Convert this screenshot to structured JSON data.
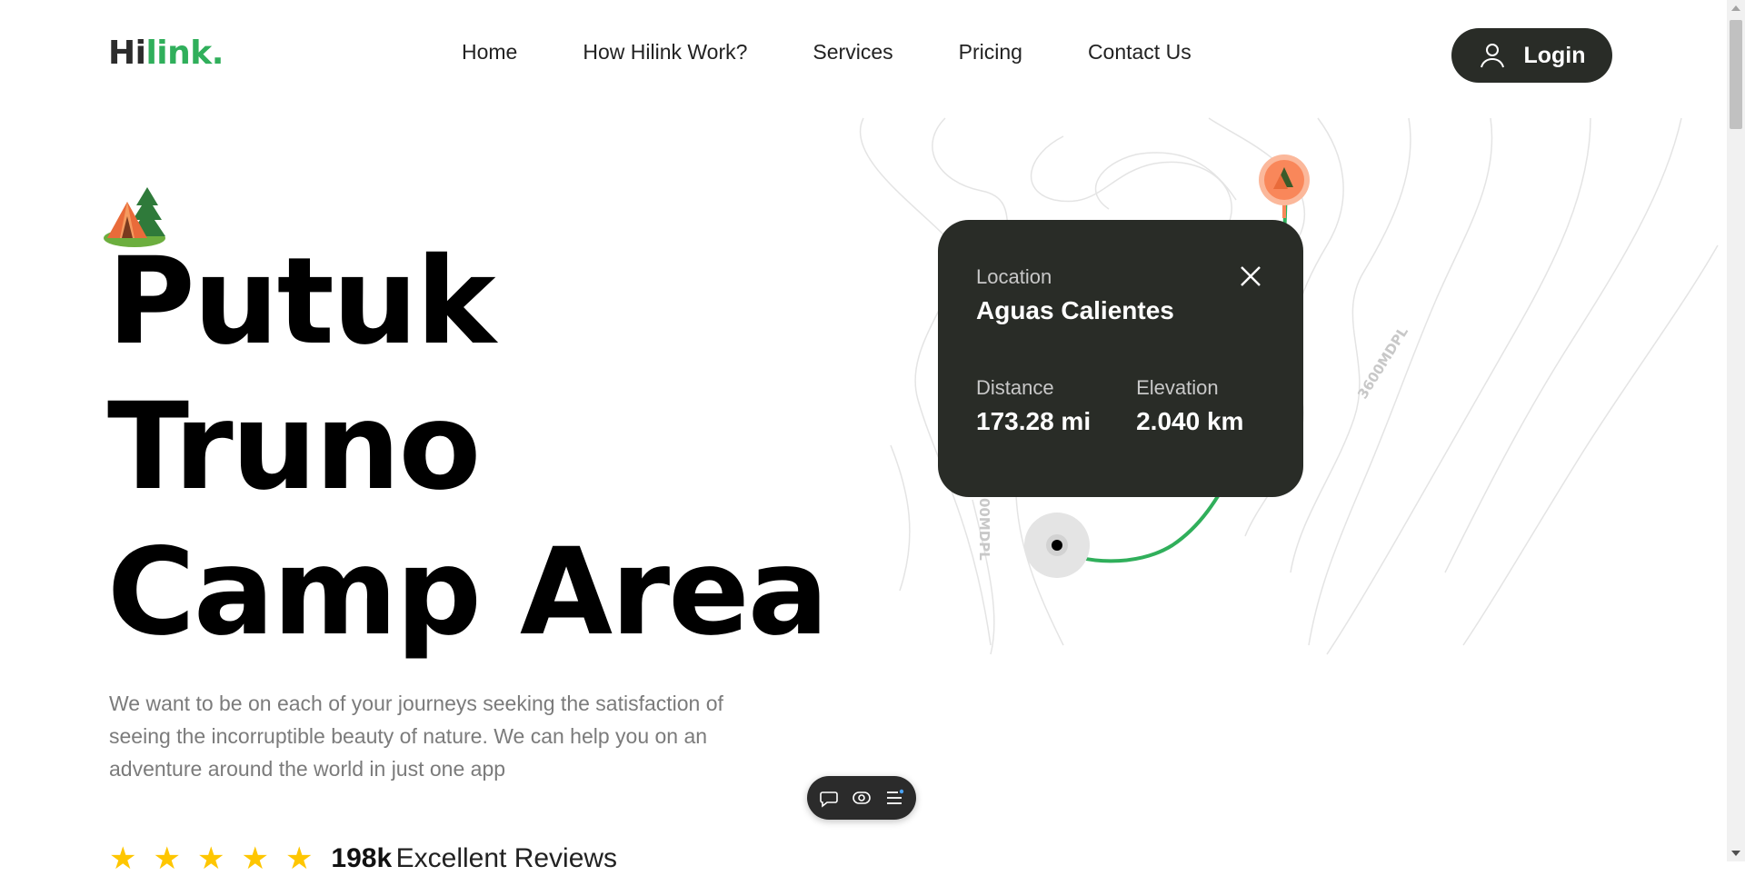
{
  "header": {
    "logo_part1": "Hi",
    "logo_part2": "link.",
    "nav": [
      "Home",
      "How Hilink Work?",
      "Services",
      "Pricing",
      "Contact Us"
    ],
    "login_label": "Login"
  },
  "hero": {
    "title_lines": [
      "Putuk",
      "Truno",
      "Camp Area"
    ],
    "description": "We want to be on each of your journeys seeking the satisfaction of seeing the incorruptible beauty of nature. We can help you on an adventure around the world in just one app",
    "rating_stars": 5,
    "reviews_count": "198k",
    "reviews_label": "Excellent Reviews"
  },
  "map": {
    "contour_labels": [
      "3600MDPL",
      "00MDPL"
    ],
    "card": {
      "location_label": "Location",
      "location_value": "Aguas Calientes",
      "distance_label": "Distance",
      "distance_value": "173.28 mi",
      "elevation_label": "Elevation",
      "elevation_value": "2.040 km"
    }
  },
  "colors": {
    "brand_green": "#30af5b",
    "dark": "#292c27",
    "pin_orange": "#f9875a",
    "star": "#fec601"
  },
  "icons": {
    "login": "user-icon",
    "close": "close-icon",
    "toolbar": [
      "chat-bubble-icon",
      "eye-icon",
      "menu-list-icon"
    ]
  }
}
